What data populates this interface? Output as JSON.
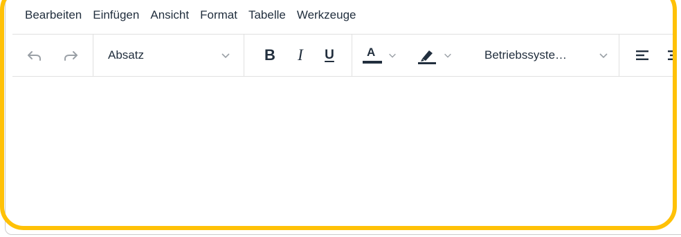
{
  "menubar": {
    "items": [
      "Bearbeiten",
      "Einfügen",
      "Ansicht",
      "Format",
      "Tabelle",
      "Werkzeuge"
    ]
  },
  "toolbar": {
    "block_format": "Absatz",
    "bold_label": "B",
    "italic_label": "I",
    "underline_label": "U",
    "font_color_label": "A",
    "font_family": "Betriebssyste…"
  },
  "colors": {
    "highlight": "#ffc107",
    "icon_disabled": "#9aa0a6",
    "text": "#222f3e"
  },
  "icons": [
    "undo-icon",
    "redo-icon",
    "chevron-down-icon",
    "text-color-icon",
    "highlight-pen-icon",
    "align-left-icon",
    "align-center-icon"
  ]
}
